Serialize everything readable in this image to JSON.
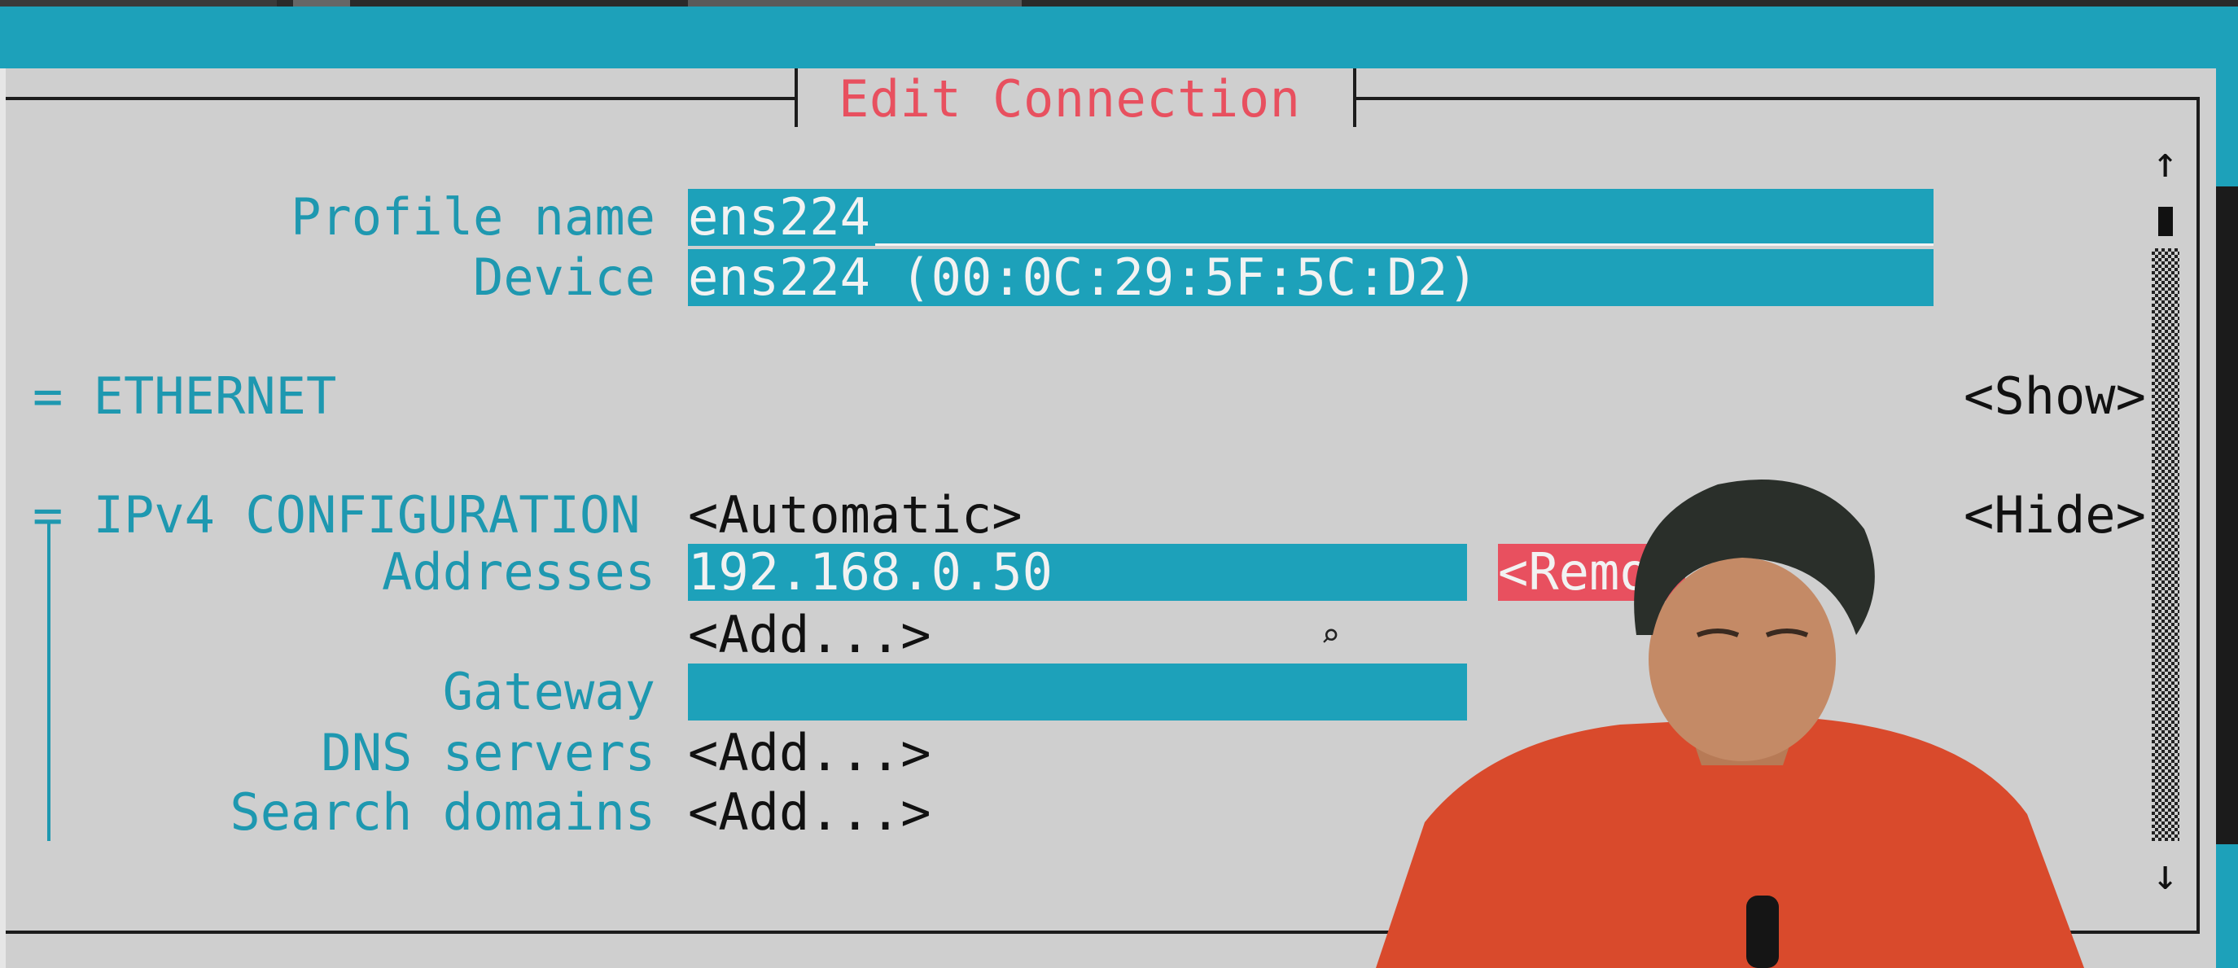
{
  "window": {
    "title": "Edit Connection"
  },
  "profile": {
    "label": "Profile name",
    "value": "ens224"
  },
  "device": {
    "label": "Device",
    "value": "ens224 (00:0C:29:5F:5C:D2)"
  },
  "ethernet": {
    "eq": "=",
    "label": "ETHERNET",
    "toggle": "<Show>"
  },
  "ipv4": {
    "eq": "=",
    "label": "IPv4 CONFIGURATION",
    "mode": "<Automatic>",
    "toggle": "<Hide>",
    "addresses_label": "Addresses",
    "address_value": "192.168.0.50",
    "remove_label": "<Remov",
    "add_address": "<Add...>",
    "gateway_label": "Gateway",
    "gateway_value": "",
    "dns_label": "DNS servers",
    "dns_add": "<Add...>",
    "search_label": "Search domains",
    "search_add": "<Add...>"
  },
  "scroll": {
    "up": "↑",
    "down": "↓"
  },
  "colors": {
    "accent": "#1da1ba",
    "title": "#e8505f",
    "background": "#cfcfcf"
  }
}
